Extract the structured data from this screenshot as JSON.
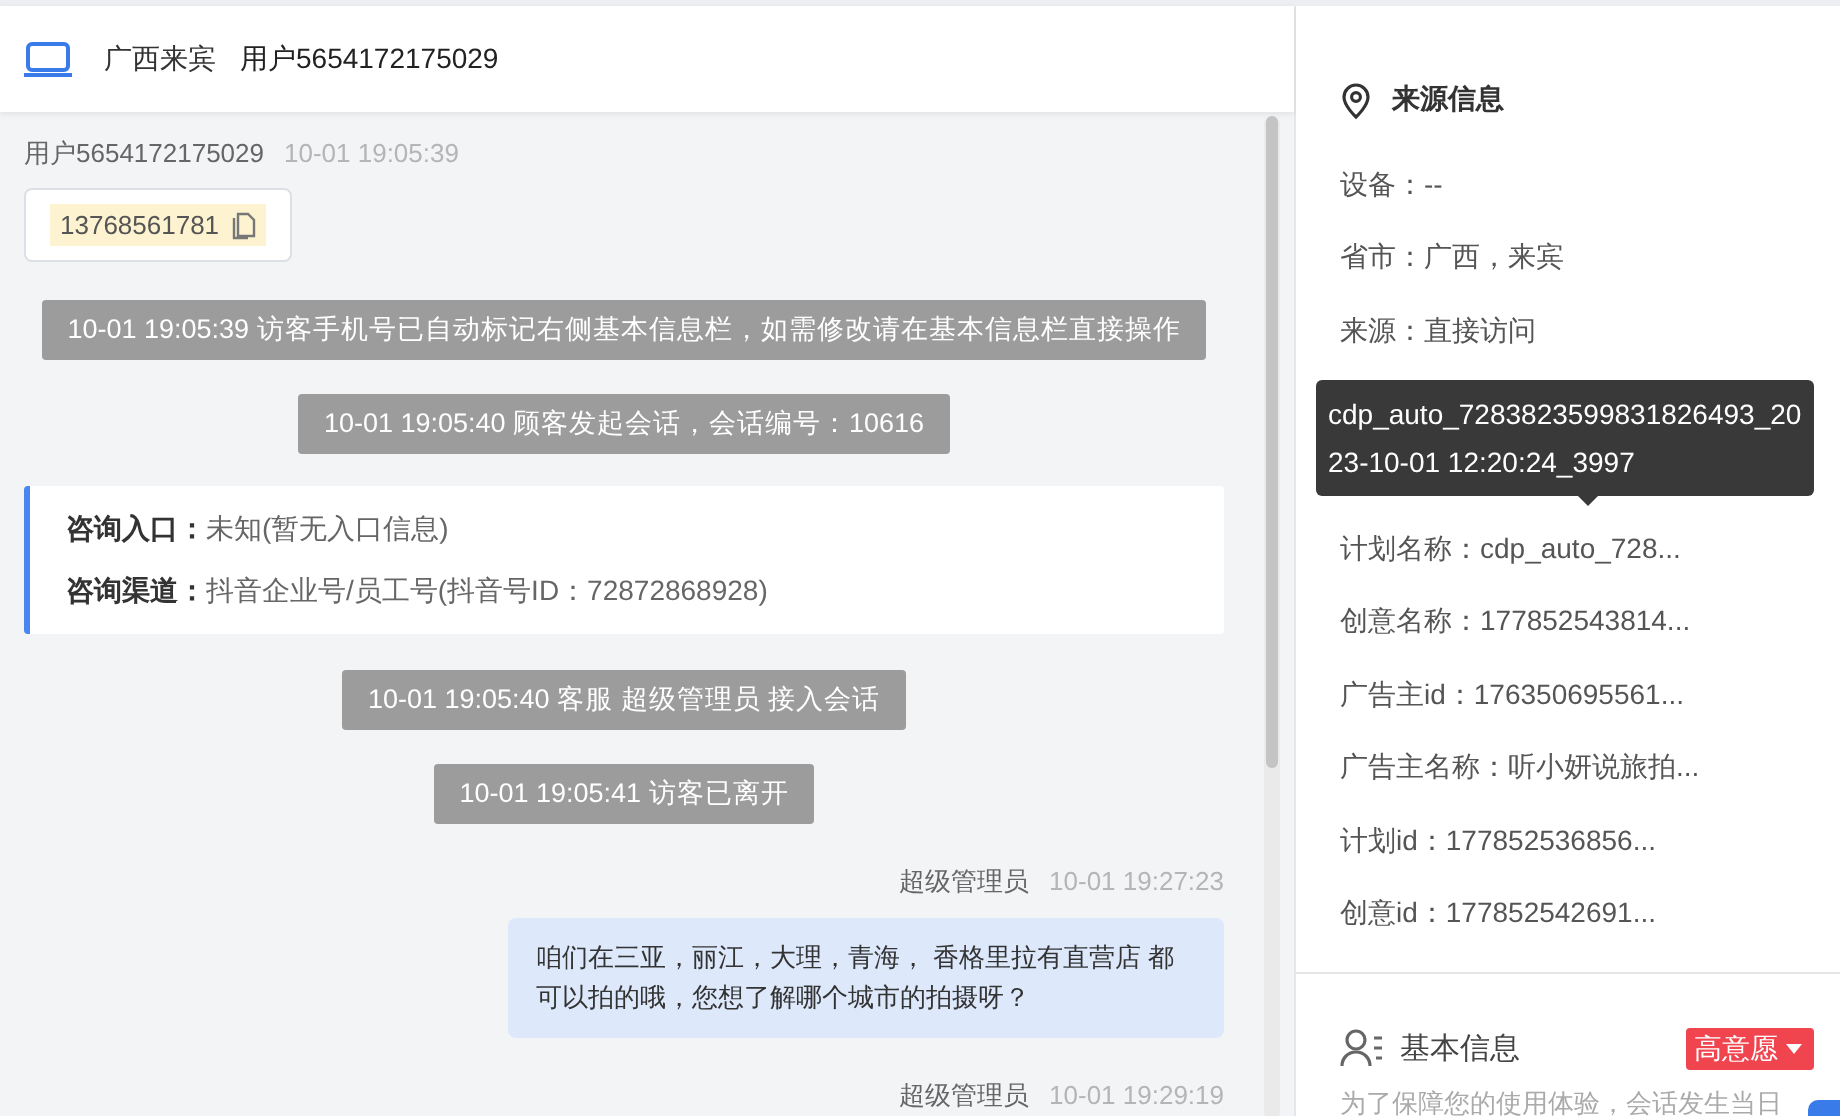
{
  "header": {
    "location": "广西来宾",
    "user": "用户5654172175029"
  },
  "messages": [
    {
      "kind": "visitor",
      "sender": "用户5654172175029",
      "time": "10-01 19:05:39",
      "phone": "13768561781"
    },
    {
      "kind": "notice",
      "text": "10-01 19:05:39 访客手机号已自动标记右侧基本信息栏，如需修改请在基本信息栏直接操作"
    },
    {
      "kind": "notice",
      "text": "10-01 19:05:40 顾客发起会话，会话编号：10616"
    },
    {
      "kind": "entry",
      "fields": [
        {
          "label": "咨询入口：",
          "value": "未知(暂无入口信息)"
        },
        {
          "label": "咨询渠道：",
          "value": "抖音企业号/员工号(抖音号ID：72872868928)"
        }
      ]
    },
    {
      "kind": "notice",
      "text": "10-01 19:05:40 客服 超级管理员 接入会话"
    },
    {
      "kind": "notice",
      "text": "10-01 19:05:41 访客已离开"
    },
    {
      "kind": "agent",
      "sender": "超级管理员",
      "time": "10-01 19:27:23",
      "text": "咱们在三亚，丽江，大理，青海， 香格里拉有直营店 都可以拍的哦，您想了解哪个城市的拍摄呀？"
    },
    {
      "kind": "agent",
      "sender": "超级管理员",
      "time": "10-01 19:29:19"
    }
  ],
  "source_info": {
    "title": "来源信息",
    "rows": [
      {
        "text": "设备：--"
      },
      {
        "text": "省市：广西，来宾"
      },
      {
        "text": "来源：直接访问"
      },
      {
        "text": "计划名称：cdp_auto_728..."
      },
      {
        "text": "创意名称：177852543814..."
      },
      {
        "text": "广告主id：176350695561..."
      },
      {
        "text": "广告主名称：听小妍说旅拍..."
      },
      {
        "text": "计划id：177852536856..."
      },
      {
        "text": "创意id：177852542691..."
      }
    ]
  },
  "tooltip": {
    "lines": [
      "cdp_auto_7283823599831826493_20",
      "23-10-01 12:20:24_3997"
    ]
  },
  "basic_info": {
    "title": "基本信息",
    "badge": "高意愿",
    "note": "为了保障您的使用体验，会话发生当日"
  }
}
